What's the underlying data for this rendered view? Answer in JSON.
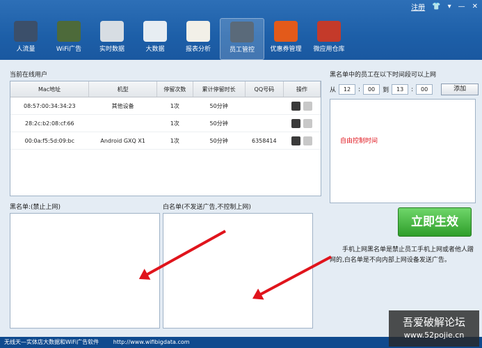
{
  "window": {
    "register": "注册"
  },
  "toolbar": [
    {
      "label": "人流量",
      "color": "#3b4f6a",
      "icon": "chart-icon"
    },
    {
      "label": "WiFi广告",
      "color": "#4d6a3a",
      "icon": "wifi-icon"
    },
    {
      "label": "实时数据",
      "color": "#d7dde3",
      "icon": "grid-icon"
    },
    {
      "label": "大数据",
      "color": "#e7edf2",
      "icon": "browser-icon"
    },
    {
      "label": "报表分析",
      "color": "#f2f0e8",
      "icon": "report-icon"
    },
    {
      "label": "员工管控",
      "color": "#5a6a7a",
      "icon": "phone-icon"
    },
    {
      "label": "优惠券管理",
      "color": "#e35a1a",
      "icon": "coupon-icon"
    },
    {
      "label": "微应用仓库",
      "color": "#c43a2a",
      "icon": "apps-icon"
    }
  ],
  "online": {
    "title": "当前在线用户",
    "columns": [
      "Mac地址",
      "机型",
      "停留次数",
      "累计停留时长",
      "QQ号码",
      "操作"
    ],
    "rows": [
      [
        "08:57:00:34:34:23",
        "其他设备",
        "1次",
        "50分钟",
        ""
      ],
      [
        "28:2c:b2:08:cf:66",
        "",
        "1次",
        "50分钟",
        ""
      ],
      [
        "00:0a:f5:5d:09:bc",
        "Android GXQ X1",
        "1次",
        "50分钟",
        "6358414"
      ]
    ]
  },
  "blacklist": {
    "title": "黑名单:(禁止上网)"
  },
  "whitelist": {
    "title": "白名单(不发送广告,不控制上网)"
  },
  "right": {
    "title": "黑名单中的员工在以下时间段可以上网",
    "from": "从",
    "h1": "12",
    "m1": "00",
    "to": "到",
    "h2": "13",
    "m2": "00",
    "add": "添加",
    "free": "自由控制时间",
    "effect": "立即生效",
    "note": "手机上网黑名单是禁止员工手机上网或者他人蹭网的,白名单是不向内部上网设备发送广告。"
  },
  "footer": {
    "text": "无线天—实体店大数据和WiFi广告软件",
    "url": "http://www.wifibigdata.com"
  },
  "watermark": {
    "line1": "吾爱破解论坛",
    "line2": "www.52pojie.cn"
  }
}
